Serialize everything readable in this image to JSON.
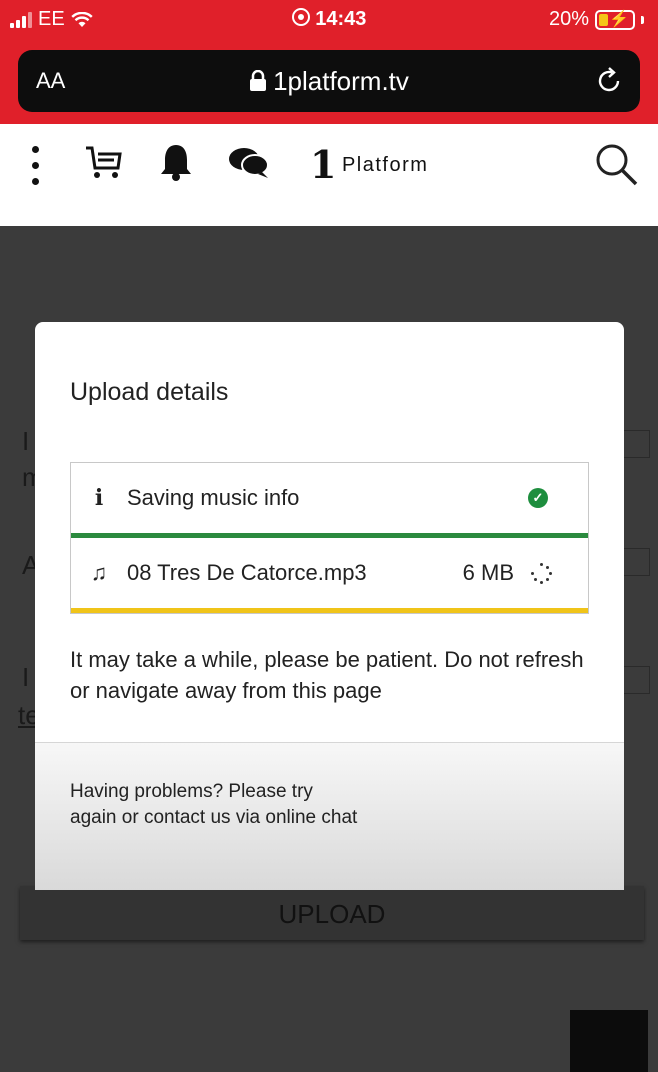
{
  "status_bar": {
    "carrier": "EE",
    "time": "14:43",
    "battery": "20%",
    "icons": [
      "signal-icon",
      "wifi-icon",
      "location-icon",
      "battery-charging-icon"
    ]
  },
  "browser": {
    "text_size_label": "AA",
    "url": "1platform.tv",
    "icons": [
      "lock-icon",
      "reload-icon"
    ]
  },
  "site_header": {
    "logo_mark": "1",
    "logo_text": "Platform",
    "icons": [
      "menu-dots-icon",
      "cart-icon",
      "bell-icon",
      "chat-icon",
      "search-icon"
    ]
  },
  "background": {
    "fragments": [
      "I",
      "m",
      "A",
      "I",
      "te"
    ],
    "upload_button": "UPLOAD"
  },
  "modal": {
    "title": "Upload details",
    "items": [
      {
        "icon": "info-icon",
        "label": "Saving music info",
        "status": "done",
        "status_color": "#1e8e3e",
        "bar_color": "#2b8a3e"
      },
      {
        "icon": "music-note-icon",
        "label": "08 Tres De Catorce.mp3",
        "size": "6 MB",
        "status": "loading",
        "bar_color": "#f0c419"
      }
    ],
    "note": "It may take a while, please be patient. Do not refresh or navigate away from this page",
    "help_text": "Having problems? Please try again or contact us via online chat"
  },
  "colors": {
    "status_bar": "#e0202a",
    "overlay": "#3b3b3b",
    "success": "#1e8e3e",
    "warning": "#f0c419"
  }
}
